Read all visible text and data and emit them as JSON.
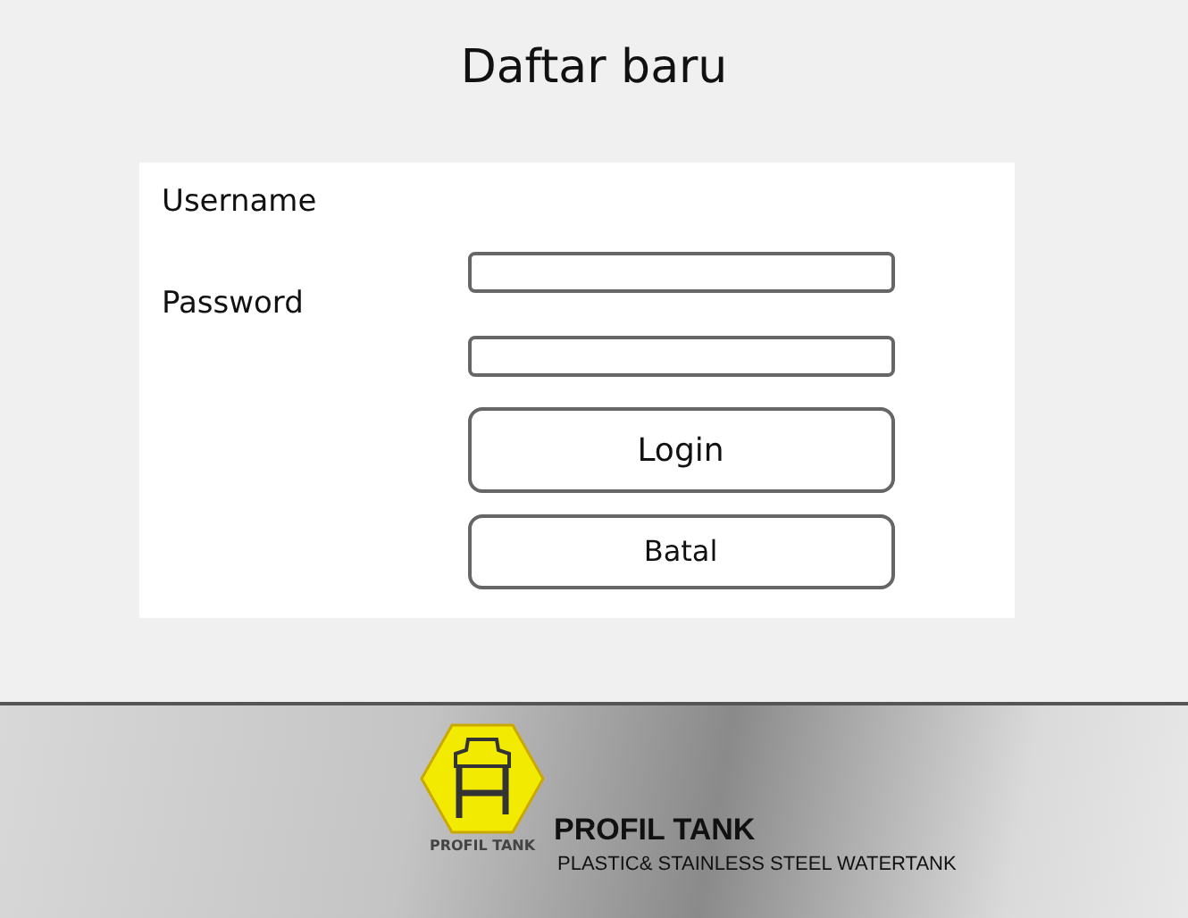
{
  "title": "Daftar baru",
  "form": {
    "username_label": "Username",
    "password_label": "Password",
    "buttons": [
      "Login",
      "Batal"
    ]
  },
  "footer": {
    "logo_caption": "PROFIL TANK",
    "brand": "PROFIL TANK",
    "tagline": "PLASTIC& STAINLESS STEEL WATERTANK"
  }
}
